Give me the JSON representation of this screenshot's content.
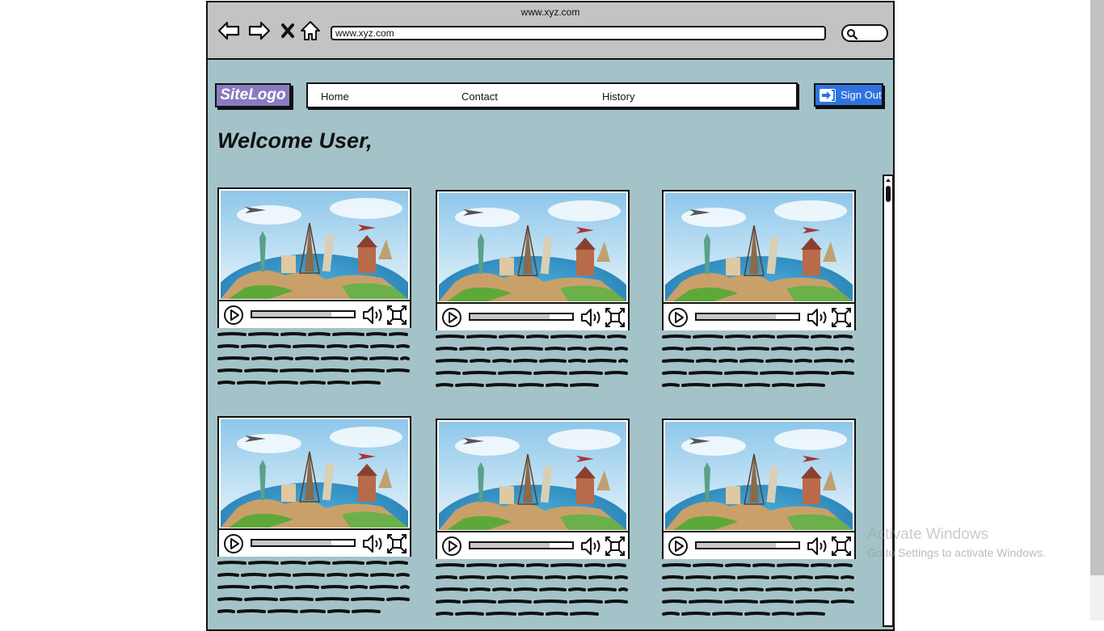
{
  "browser": {
    "window_title": "www.xyz.com",
    "url": "www.xyz.com",
    "nav_icons": [
      "back-arrow-icon",
      "forward-arrow-icon",
      "close-icon",
      "home-icon"
    ],
    "search_icon": "search-icon"
  },
  "header": {
    "logo": "SiteLogo",
    "nav": [
      "Home",
      "Contact",
      "History"
    ],
    "signout_label": "Sign Out",
    "signout_icon": "sign-in-arrow-icon"
  },
  "main": {
    "welcome": "Welcome User,",
    "video_count": 6,
    "video_progress": 0.78
  },
  "os": {
    "watermark_title": "Activate Windows",
    "watermark_sub": "Go to Settings to activate Windows."
  },
  "colors": {
    "page_bg": "#a3c3c9",
    "browser_bar": "#c3c3c3",
    "logo_bg": "#8a7bc0",
    "signout_bg": "#2f73e0"
  }
}
